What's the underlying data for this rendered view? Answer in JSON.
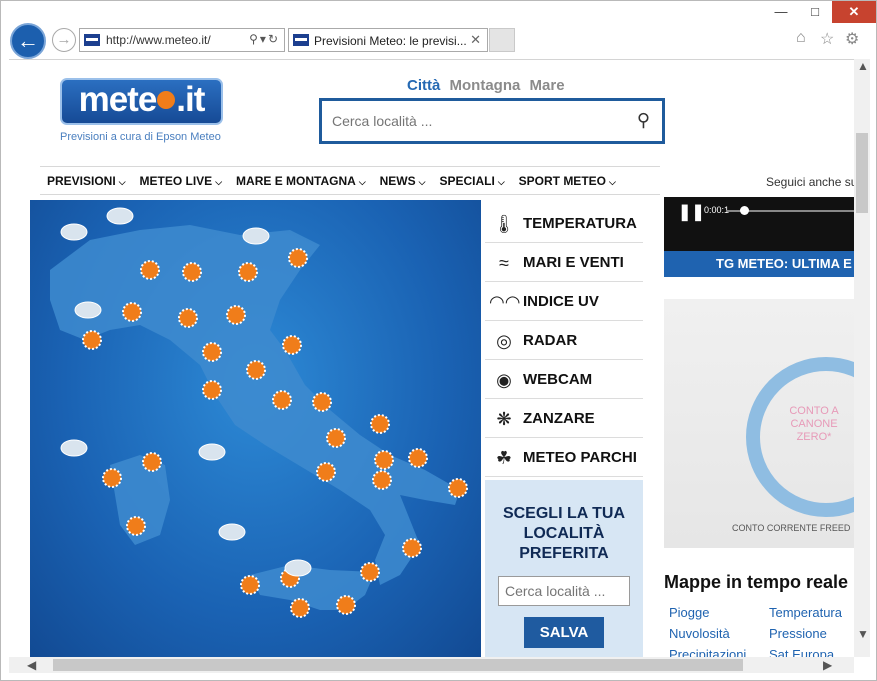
{
  "browser": {
    "url": "http://www.meteo.it/",
    "tab_title": "Previsioni Meteo: le previsi...",
    "controls": {
      "minimize": "—",
      "maximize": "□",
      "close": "✕"
    },
    "icons": [
      "back-arrow-icon",
      "forward-arrow-icon",
      "search-icon",
      "refresh-icon",
      "home-icon",
      "star-icon",
      "gear-icon"
    ]
  },
  "header": {
    "logo_left": "mete",
    "logo_right": ".it",
    "tagline": "Previsioni a cura di Epson Meteo",
    "search_tabs": [
      {
        "label": "Città",
        "active": true
      },
      {
        "label": "Montagna",
        "active": false
      },
      {
        "label": "Mare",
        "active": false
      }
    ],
    "search_placeholder": "Cerca località ..."
  },
  "menu": [
    {
      "label": "PREVISIONI"
    },
    {
      "label": "METEO LIVE"
    },
    {
      "label": "MARE E MONTAGNA"
    },
    {
      "label": "NEWS"
    },
    {
      "label": "SPECIALI"
    },
    {
      "label": "SPORT METEO"
    }
  ],
  "follow_text": "Seguici anche su",
  "side_links": [
    {
      "label": "TEMPERATURA",
      "icon": "thermometer-icon"
    },
    {
      "label": "MARI E VENTI",
      "icon": "wind-waves-icon"
    },
    {
      "label": "INDICE UV",
      "icon": "sunglasses-icon"
    },
    {
      "label": "RADAR",
      "icon": "radar-icon"
    },
    {
      "label": "WEBCAM",
      "icon": "webcam-icon"
    },
    {
      "label": "ZANZARE",
      "icon": "mosquito-icon"
    },
    {
      "label": "METEO PARCHI",
      "icon": "park-icon"
    }
  ],
  "preferred": {
    "title": "SCEGLI LA TUA LOCALITÀ PREFERITA",
    "placeholder": "Cerca località ...",
    "button": "SALVA"
  },
  "video": {
    "time": "0:00:1",
    "caption": "TG METEO: ULTIMA E"
  },
  "ad": {
    "text": "CONTO A CANONE ZERO*",
    "footer": "CONTO CORRENTE FREED"
  },
  "maps_section": {
    "title": "Mappe in tempo reale",
    "links": [
      "Piogge",
      "Temperatura",
      "Nuvolosità",
      "Pressione",
      "Precipitazioni",
      "Sat Europa"
    ]
  },
  "colors": {
    "brand_blue": "#1f63b0",
    "sun_orange": "#f07d1a",
    "close_red": "#c7432f"
  }
}
